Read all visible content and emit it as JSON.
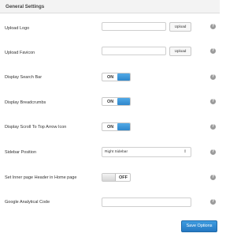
{
  "panel": {
    "title": "General Settings"
  },
  "settings": {
    "upload_logo": {
      "label": "Upload Logo",
      "value": "",
      "button": "Upload"
    },
    "upload_favicon": {
      "label": "Upload Favicon",
      "value": "",
      "button": "Upload"
    },
    "display_search_bar": {
      "label": "Display Search Bar",
      "state": "ON"
    },
    "display_breadcrumbs": {
      "label": "Display Breadcrumbs",
      "state": "ON"
    },
    "display_scroll_top": {
      "label": "Display Scroll To Top Arrow Icon",
      "state": "ON"
    },
    "sidebar_position": {
      "label": "Sidebar Position",
      "selected": "Right Sidebar"
    },
    "inner_page_header": {
      "label": "Set Inner page Header in Home page",
      "state": "OFF"
    },
    "google_analytics": {
      "label": "Google Analytical Code",
      "value": ""
    }
  },
  "help_glyph": "?",
  "save_label": "Save Options",
  "colors": {
    "accent": "#2f87cb",
    "toggle_off": "#d5d5d5",
    "help_icon": "#9b9b9b"
  },
  "icons": [
    "help-icon",
    "chevron-updown-icon"
  ]
}
